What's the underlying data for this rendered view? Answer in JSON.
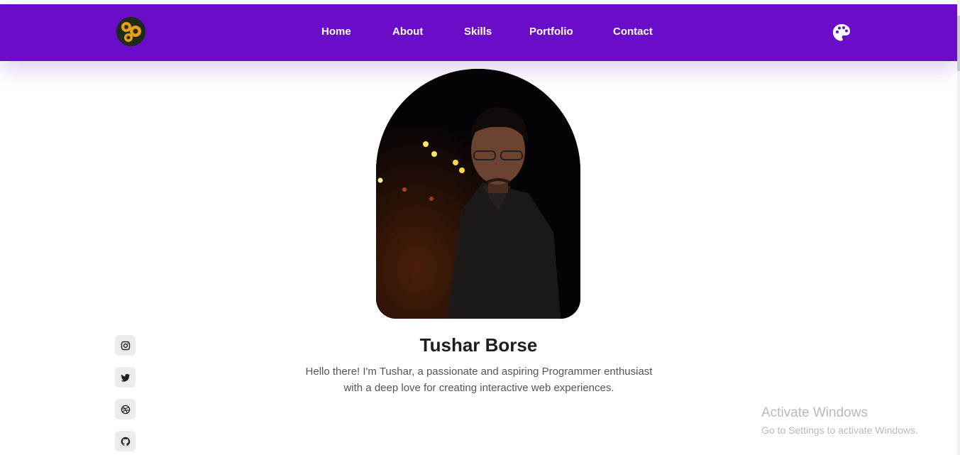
{
  "nav": {
    "items": [
      {
        "label": "Home"
      },
      {
        "label": "About"
      },
      {
        "label": "Skills"
      },
      {
        "label": "Portfolio"
      },
      {
        "label": "Contact"
      }
    ],
    "logo_icon": "sunflower-avatar",
    "theme_icon": "palette-icon",
    "accent_color": "#6a0dc8"
  },
  "hero": {
    "name": "Tushar Borse",
    "bio_line1": "Hello there! I'm Tushar, a passionate and aspiring Programmer enthusiast",
    "bio_line2": "with a deep love for creating interactive web experiences."
  },
  "social": [
    {
      "icon": "instagram-icon"
    },
    {
      "icon": "twitter-icon"
    },
    {
      "icon": "dribbble-icon"
    },
    {
      "icon": "github-icon"
    }
  ],
  "os_watermark": {
    "title": "Activate Windows",
    "subtitle": "Go to Settings to activate Windows."
  }
}
